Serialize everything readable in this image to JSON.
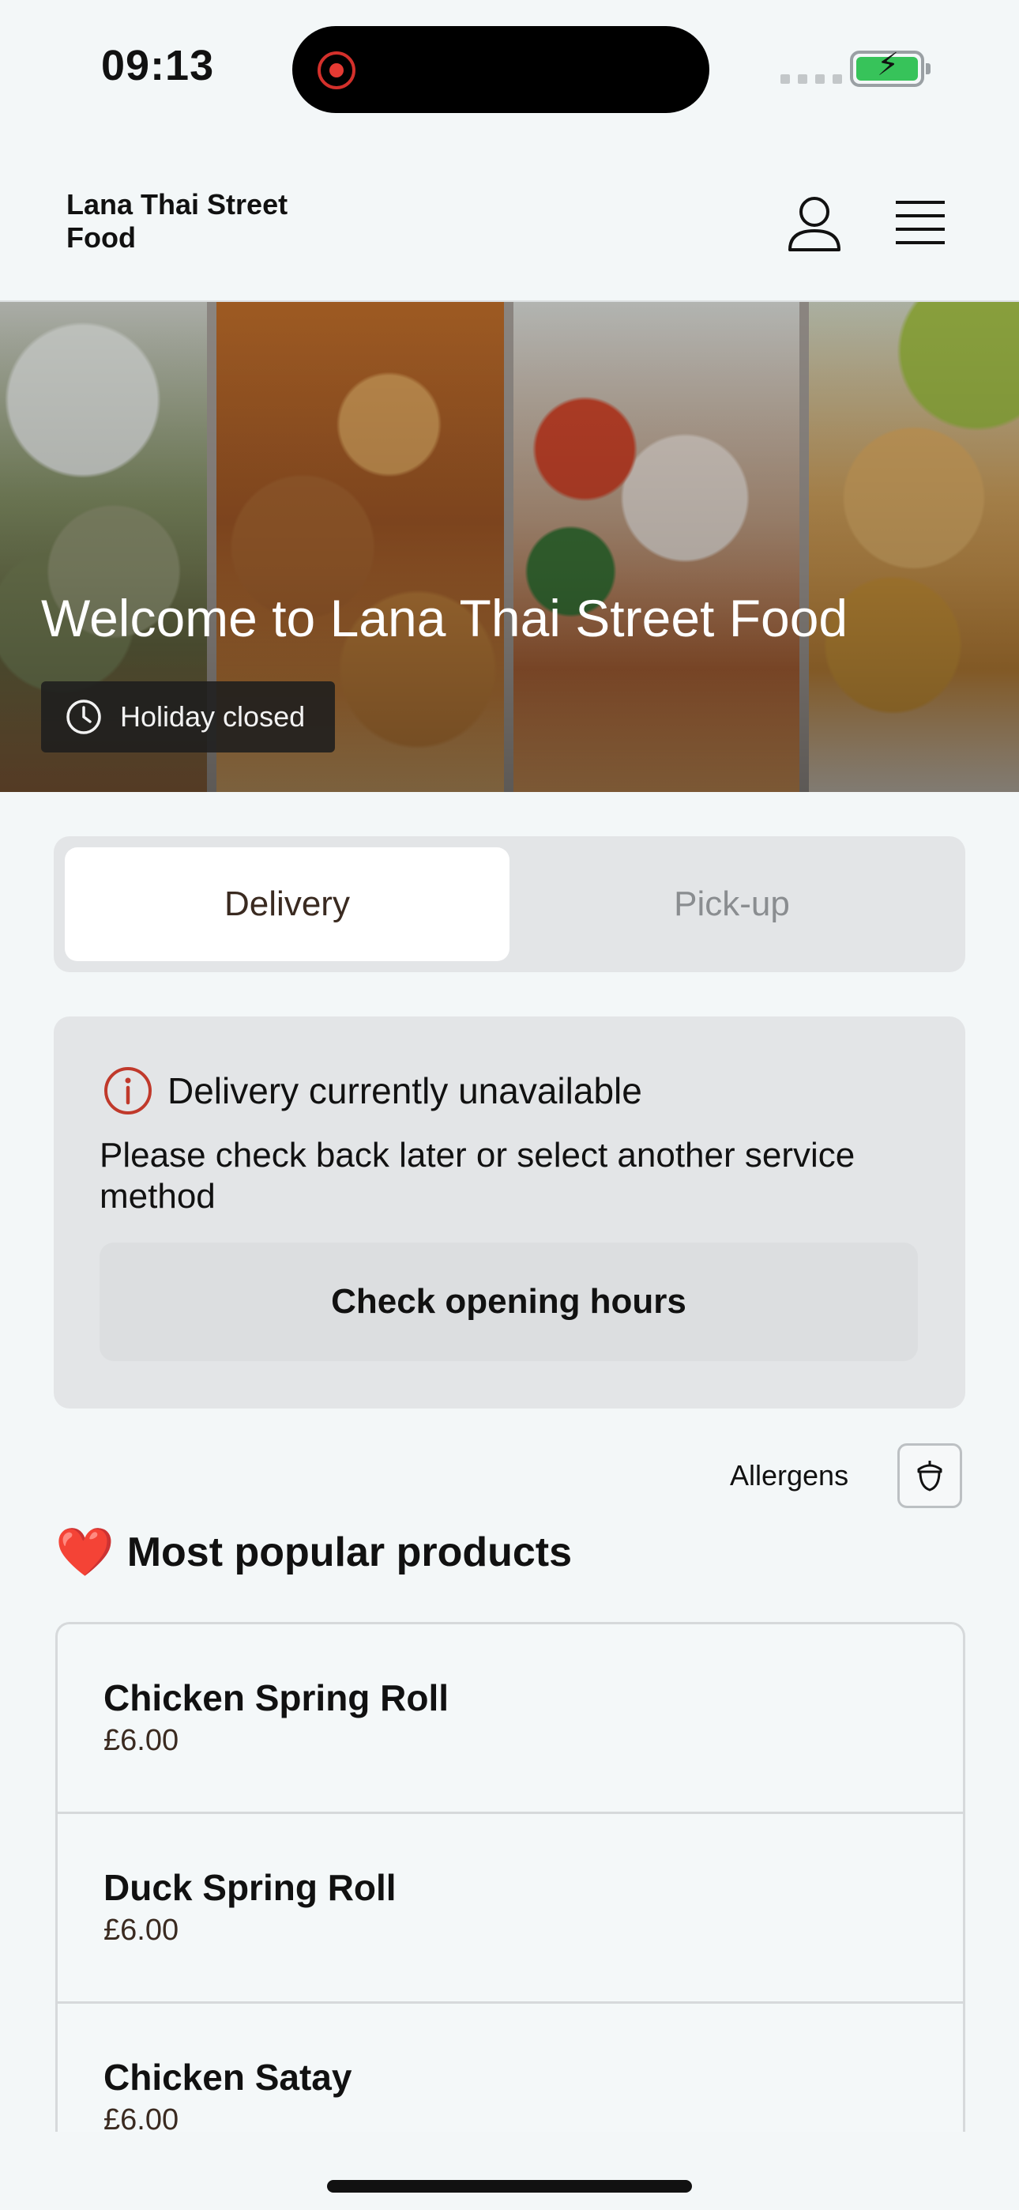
{
  "status_bar": {
    "time": "09:13"
  },
  "header": {
    "brand": "Lana Thai Street Food"
  },
  "hero": {
    "title": "Welcome to Lana Thai Street Food",
    "status": "Holiday closed"
  },
  "service": {
    "options": [
      {
        "label": "Delivery",
        "selected": true
      },
      {
        "label": "Pick-up",
        "selected": false
      }
    ]
  },
  "notice": {
    "title": "Delivery currently unavailable",
    "body": "Please check back later or select another service method",
    "button": "Check opening hours"
  },
  "allergens": {
    "label": "Allergens"
  },
  "popular": {
    "title": "Most popular products",
    "emoji": "❤️",
    "products": [
      {
        "name": "Chicken Spring Roll",
        "price": "£6.00"
      },
      {
        "name": "Duck Spring Roll",
        "price": "£6.00"
      },
      {
        "name": "Chicken Satay",
        "price": "£6.00"
      }
    ]
  },
  "colors": {
    "accent_red": "#c0392b",
    "background": "#f3f7f8",
    "card": "#e3e5e7"
  }
}
